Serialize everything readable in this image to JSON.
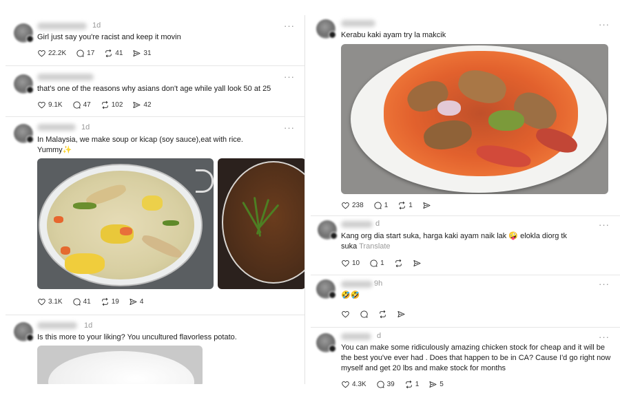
{
  "colors": {
    "text": "#101010",
    "muted": "#9a9a9a",
    "divider": "#e6e6e6"
  },
  "left_posts": [
    {
      "time": "1d",
      "text": "Girl just say you're racist and keep it movin",
      "likes": "22.2K",
      "replies": "17",
      "reposts": "41",
      "shares": "31"
    },
    {
      "time": "",
      "text": "that's one of the reasons why asians don't age while yall look 50 at 25",
      "likes": "9.1K",
      "replies": "47",
      "reposts": "102",
      "shares": "42"
    },
    {
      "time": "1d",
      "text_line1": "In Malaysia, we make soup or kicap (soy sauce),eat with rice.",
      "text_line2": "Yummy",
      "emoji": "✨",
      "likes": "3.1K",
      "replies": "41",
      "reposts": "19",
      "shares": "4"
    },
    {
      "time": "1d",
      "text": "Is this more to your liking? You uncultured flavorless potato."
    }
  ],
  "right_posts": [
    {
      "time": "",
      "text": "Kerabu kaki ayam try la makcik",
      "likes": "238",
      "replies": "1",
      "reposts": "1"
    },
    {
      "time": "d",
      "text_line1": "Kang org dia start suka, harga kaki ayam naik lak 🤪 elokla diorg tk",
      "text_line2": "suka",
      "translate": "Translate",
      "likes": "10",
      "replies": "1"
    },
    {
      "time": "9h",
      "text": "🤣🤣"
    },
    {
      "time": "d",
      "text_line1": "You can make some ridiculously amazing chicken stock for cheap and it will be",
      "text_line2": "the best you've ever had . Does that happen to be in CA? Cause I'd go right now",
      "text_line3": "myself and get 20 lbs and make stock for months",
      "likes": "4.3K",
      "replies": "39",
      "reposts": "1",
      "shares": "5"
    }
  ],
  "more_label": "···",
  "icons": [
    "heart-icon",
    "reply-icon",
    "repost-icon",
    "share-icon",
    "more-icon"
  ]
}
